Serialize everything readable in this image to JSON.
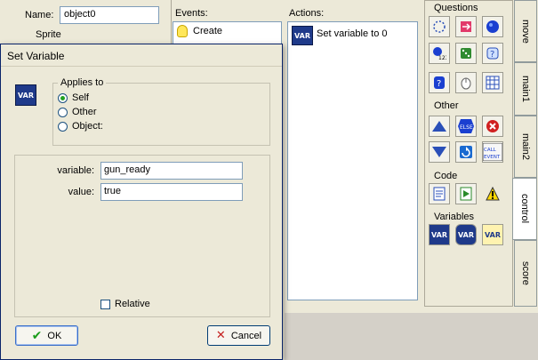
{
  "object_properties": {
    "name_label": "Name:",
    "name_value": "object0",
    "sprite_label": "Sprite"
  },
  "events": {
    "label": "Events:",
    "items": [
      {
        "label": "Create",
        "icon": "lightbulb-icon"
      }
    ]
  },
  "actions": {
    "label": "Actions:",
    "items": [
      {
        "label": "Set variable  to 0",
        "icon": "var-icon",
        "icon_text": "VAR"
      }
    ]
  },
  "palette": {
    "sections": [
      {
        "title": "Questions"
      },
      {
        "title": "Other",
        "icons": [
          "up-triangle-icon",
          "else-icon",
          "exit-icon",
          "down-triangle-icon",
          "repeat-icon",
          "call-event-icon"
        ],
        "labels": {
          "else": "ELSE",
          "call_event": "CALL EVENT"
        }
      },
      {
        "title": "Code"
      },
      {
        "title": "Variables",
        "var_text": "VAR"
      }
    ]
  },
  "tabs": [
    "move",
    "main1",
    "main2",
    "control",
    "score"
  ],
  "active_tab": "control",
  "dialog": {
    "title": "Set Variable",
    "icon_text": "VAR",
    "applies_to_label": "Applies to",
    "applies_options": [
      {
        "label": "Self",
        "selected": true
      },
      {
        "label": "Other",
        "selected": false
      },
      {
        "label": "Object:",
        "selected": false
      }
    ],
    "variable_label": "variable:",
    "variable_value": "gun_ready",
    "value_label": "value:",
    "value_value": "true",
    "relative_label": "Relative",
    "relative_checked": false,
    "ok_label": "OK",
    "cancel_label": "Cancel"
  }
}
